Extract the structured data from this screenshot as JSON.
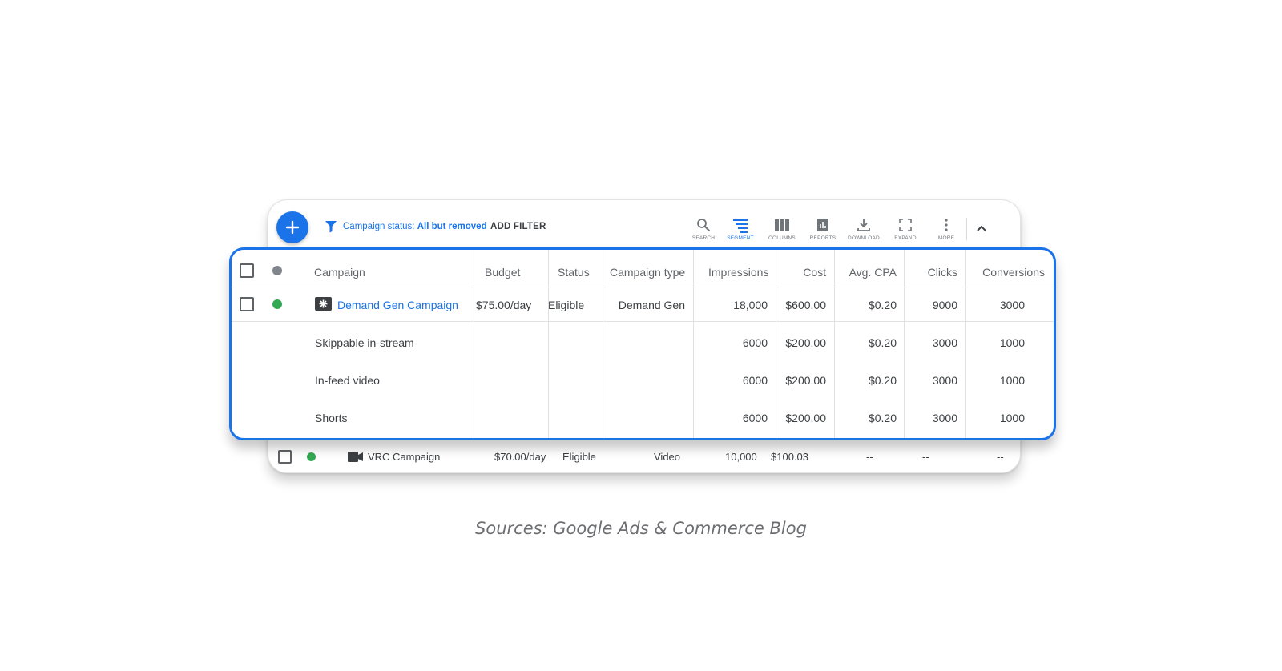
{
  "toolbar": {
    "filter_prefix": "Campaign status:",
    "filter_value": "All but removed",
    "add_filter": "ADD FILTER",
    "tools": [
      {
        "label": "SEARCH",
        "icon": "search-icon"
      },
      {
        "label": "SEGMENT",
        "icon": "segment-icon",
        "active": true
      },
      {
        "label": "COLUMNS",
        "icon": "columns-icon"
      },
      {
        "label": "REPORTS",
        "icon": "reports-icon"
      },
      {
        "label": "DOWNLOAD",
        "icon": "download-icon"
      },
      {
        "label": "EXPAND",
        "icon": "expand-icon"
      },
      {
        "label": "MORE",
        "icon": "more-icon"
      }
    ]
  },
  "table": {
    "headers": {
      "campaign": "Campaign",
      "budget": "Budget",
      "status": "Status",
      "campaign_type": "Campaign type",
      "impressions": "Impressions",
      "cost": "Cost",
      "avg_cpa": "Avg. CPA",
      "clicks": "Clicks",
      "conversions": "Conversions"
    },
    "campaign": {
      "name": "Demand Gen Campaign",
      "budget": "$75.00/day",
      "status": "Eligible",
      "campaign_type": "Demand Gen",
      "impressions": "18,000",
      "cost": "$600.00",
      "avg_cpa": "$0.20",
      "clicks": "9000",
      "conversions": "3000",
      "status_color": "#34a853"
    },
    "segments": [
      {
        "name": "Skippable in-stream",
        "impressions": "6000",
        "cost": "$200.00",
        "avg_cpa": "$0.20",
        "clicks": "3000",
        "conversions": "1000"
      },
      {
        "name": "In-feed video",
        "impressions": "6000",
        "cost": "$200.00",
        "avg_cpa": "$0.20",
        "clicks": "3000",
        "conversions": "1000"
      },
      {
        "name": "Shorts",
        "impressions": "6000",
        "cost": "$200.00",
        "avg_cpa": "$0.20",
        "clicks": "3000",
        "conversions": "1000"
      }
    ]
  },
  "vrc_row": {
    "name": "VRC Campaign",
    "budget": "$70.00/day",
    "status": "Eligible",
    "campaign_type": "Video",
    "impressions": "10,000",
    "cost": "$100.03",
    "avg_cpa": "--",
    "clicks": "--",
    "conversions": "--",
    "status_color": "#34a853"
  },
  "caption": "Sources: Google Ads & Commerce Blog",
  "colors": {
    "accent": "#1a73e8",
    "status_ok": "#34a853",
    "header_dot": "#80868b"
  }
}
